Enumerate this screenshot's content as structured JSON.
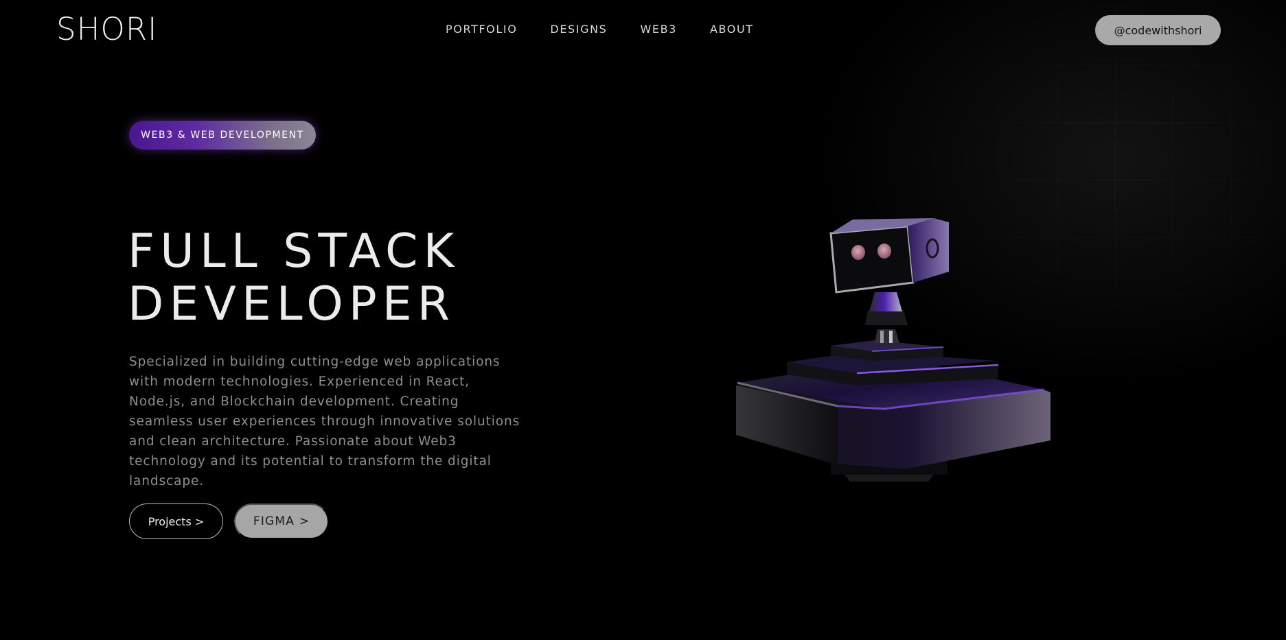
{
  "header": {
    "logo": "SHORI",
    "nav": [
      "PORTFOLIO",
      "DESIGNS",
      "WEB3",
      "ABOUT"
    ],
    "handle_button": "@codewithshori"
  },
  "hero": {
    "badge": "WEB3 & WEB DEVELOPMENT",
    "title_line1": "FULL STACK",
    "title_line2": "DEVELOPER",
    "description": "Specialized in building cutting-edge web applications with modern technologies. Experienced in React, Node.js, and Blockchain development. Creating seamless user experiences through innovative solutions and clean architecture. Passionate about Web3 technology and its potential to transform the digital landscape.",
    "buttons": {
      "projects": "Projects >",
      "figma": "FIGMA >"
    }
  },
  "colors": {
    "background": "#000000",
    "accent_purple": "#5b1fa6",
    "button_gray": "#a8a8a8"
  },
  "illustration": "3d-robot-on-pedestal"
}
